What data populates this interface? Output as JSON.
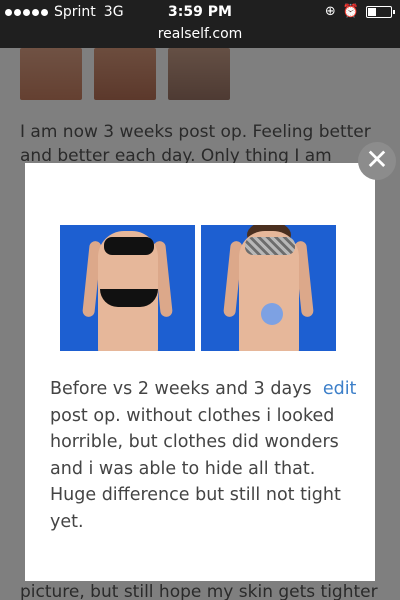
{
  "status_bar": {
    "carrier": "Sprint",
    "network": "3G",
    "time": "3:59 PM",
    "battery_level": 0.35
  },
  "browser": {
    "url": "realself.com"
  },
  "background": {
    "paragraph": "I am now 3 weeks post op. Feeling better and better each day. Only thing I am",
    "bottom_fragment": "picture, but still hope my skin gets tighter"
  },
  "modal": {
    "caption": "Before vs 2 weeks and 3 days post op. without clothes i looked horrible, but clothes did wonders and i was able to hide all that. Huge difference but still not tight yet.",
    "edit_label": "edit",
    "close_symbol": "✕"
  }
}
